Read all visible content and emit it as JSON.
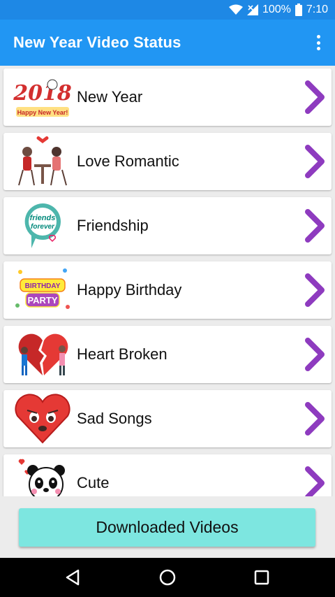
{
  "status_bar": {
    "battery": "100%",
    "time": "7:10"
  },
  "app_bar": {
    "title": "New Year Video Status"
  },
  "categories": [
    {
      "label": "New Year",
      "icon": "new-year-2018-icon",
      "icon_text_top": "2018",
      "icon_text_bottom": "Happy New Year!"
    },
    {
      "label": "Love Romantic",
      "icon": "couple-dinner-icon"
    },
    {
      "label": "Friendship",
      "icon": "friends-forever-icon",
      "icon_text_top": "friends",
      "icon_text_bottom": "forever"
    },
    {
      "label": "Happy Birthday",
      "icon": "birthday-party-icon",
      "icon_text_top": "BIRTHDAY",
      "icon_text_bottom": "PARTY"
    },
    {
      "label": "Heart Broken",
      "icon": "broken-heart-couple-icon"
    },
    {
      "label": "Sad Songs",
      "icon": "sad-heart-icon"
    },
    {
      "label": "Cute",
      "icon": "panda-icon"
    }
  ],
  "bottom": {
    "downloaded_label": "Downloaded Videos"
  },
  "colors": {
    "status_bar": "#1e88e5",
    "app_bar": "#2196f3",
    "chevron": "#8e3bbf",
    "button": "#7de6e0"
  }
}
